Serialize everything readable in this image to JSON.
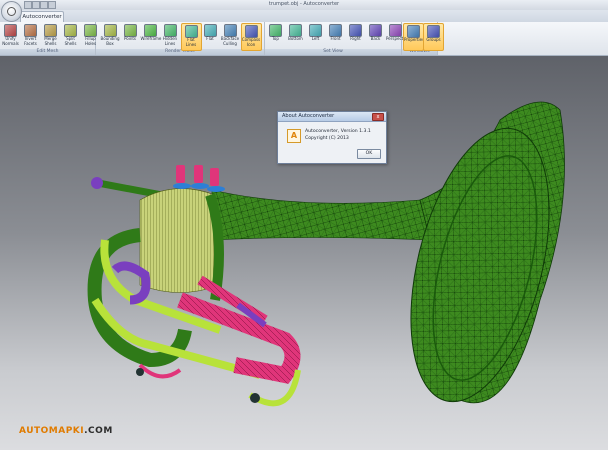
{
  "window": {
    "title": "trumpet.obj - Autoconverter"
  },
  "tabs": [
    {
      "label": "Autoconverter"
    }
  ],
  "ribbon": {
    "groups": [
      {
        "label": "Edit Mesh",
        "buttons": [
          {
            "label": "Unify\nNormals",
            "icon": "unify-normals-icon"
          },
          {
            "label": "Invert\nFacets",
            "icon": "invert-facets-icon"
          },
          {
            "label": "Merge\nShells",
            "icon": "merge-shells-icon"
          },
          {
            "label": "Split\nShells",
            "icon": "split-shells-icon"
          },
          {
            "label": "Fillup\nHoles",
            "icon": "fillup-holes-icon"
          }
        ]
      },
      {
        "label": "Render Mode",
        "buttons": [
          {
            "label": "Bounding\nBox",
            "icon": "bounding-box-icon"
          },
          {
            "label": "Points",
            "icon": "points-icon"
          },
          {
            "label": "Wireframe",
            "icon": "wireframe-icon"
          },
          {
            "label": "Hidden\nLines",
            "icon": "hidden-lines-icon"
          },
          {
            "label": "Flat\nLines",
            "icon": "flat-lines-icon",
            "active": true
          },
          {
            "label": "Flat",
            "icon": "flat-icon"
          },
          {
            "label": "Backface\nCulling",
            "icon": "backface-culling-icon"
          },
          {
            "label": "Compass\nIcon",
            "icon": "compass-icon",
            "active": true
          }
        ]
      },
      {
        "label": "Set View",
        "buttons": [
          {
            "label": "Top",
            "icon": "top-view-icon"
          },
          {
            "label": "Bottom",
            "icon": "bottom-view-icon"
          },
          {
            "label": "Left",
            "icon": "left-view-icon"
          },
          {
            "label": "Front",
            "icon": "front-view-icon"
          },
          {
            "label": "Right",
            "icon": "right-view-icon"
          },
          {
            "label": "Back",
            "icon": "back-view-icon"
          },
          {
            "label": "Perspective",
            "icon": "perspective-icon"
          }
        ]
      },
      {
        "label": "Windows",
        "buttons": [
          {
            "label": "Properties",
            "icon": "properties-icon",
            "active": true
          },
          {
            "label": "Groups",
            "icon": "groups-icon",
            "active": true
          }
        ]
      }
    ]
  },
  "dialog": {
    "title": "About Autoconverter",
    "icon_letter": "A",
    "line1": "Autoconverter, Version 1.3.1",
    "line2": "Copyright (C) 2013",
    "ok_label": "OK",
    "close_glyph": "x"
  },
  "watermark": {
    "part1": "AUTOMAPKI",
    "part2": ".COM"
  },
  "colors": {
    "accent": "#ffc95a",
    "mesh_bell": "#3d8a1f",
    "mesh_pink": "#e0357a",
    "mesh_lime": "#b8e23a",
    "mesh_purple": "#7a3fbf",
    "mesh_blue": "#2d7fd6",
    "background_top": "#5f6269",
    "background_bottom": "#dcdde0"
  }
}
